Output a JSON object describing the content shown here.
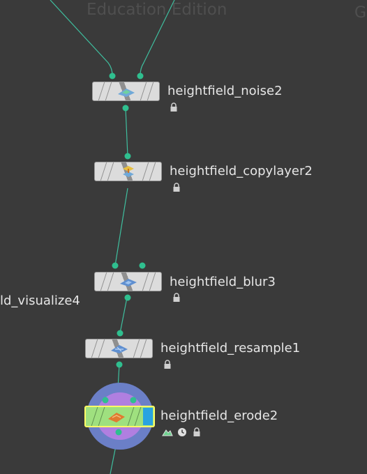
{
  "watermark": "Education Edition",
  "watermark_partial": "G",
  "side_label": "ld_visualize4",
  "nodes": [
    {
      "name": "heightfield_noise2"
    },
    {
      "name": "heightfield_copylayer2"
    },
    {
      "name": "heightfield_blur3"
    },
    {
      "name": "heightfield_resample1"
    },
    {
      "name": "heightfield_erode2"
    }
  ],
  "colors": {
    "background": "#3a3a3a",
    "wire": "#3fbf9f",
    "selected_node": "#9fe07f",
    "selected_outline": "#ffff66",
    "display_flag": "#29a3e0",
    "halo_outer": "#6b7fc7",
    "halo_inner": "#b07fe0"
  }
}
